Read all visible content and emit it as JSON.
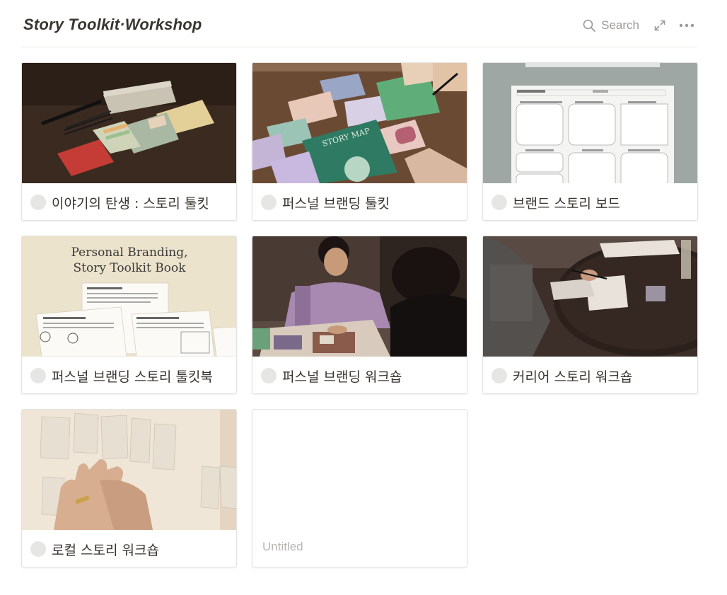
{
  "header": {
    "title": "Story Toolkit·Workshop",
    "search_label": "Search",
    "search_icon": "search-icon",
    "expand_icon": "expand-icon",
    "more_icon": "more-icon"
  },
  "cards": [
    {
      "title": "이야기의 탄생 : 스토리 툴킷",
      "cover": "toolkit-products-photo"
    },
    {
      "title": "퍼스널 브랜딩 툴킷",
      "cover": "branding-cards-photo",
      "cover_text": "STORY MAP"
    },
    {
      "title": "브랜드 스토리 보드",
      "cover": "story-board-worksheet"
    },
    {
      "title": "퍼스널 브랜딩 스토리 툴킷북",
      "cover": "toolkit-book-cover",
      "cover_text_1": "Personal Branding,",
      "cover_text_2": "Story Toolkit Book"
    },
    {
      "title": "퍼스널 브랜딩 워크숍",
      "cover": "workshop-photo"
    },
    {
      "title": "커리어 스토리 워크숍",
      "cover": "career-workshop-photo"
    },
    {
      "title": "로컬 스토리 워크숍",
      "cover": "local-workshop-photo"
    },
    {
      "title": "",
      "placeholder": "Untitled"
    }
  ],
  "colors": {
    "text": "#37352f",
    "muted": "#9b9a97",
    "border": "#e3e3e1",
    "status_dot": "#e6e6e5"
  }
}
